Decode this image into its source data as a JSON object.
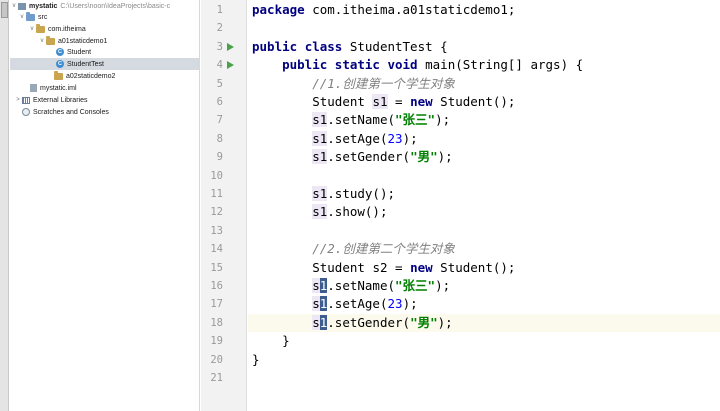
{
  "project_tree": {
    "root": {
      "name": "mystatic",
      "path": "C:\\Users\\noon\\IdeaProjects\\basic-c"
    },
    "items": [
      {
        "label": "src",
        "indent": 1,
        "icon": "source-folder-icon",
        "arrow": "v"
      },
      {
        "label": "com.itheima",
        "indent": 2,
        "icon": "package-icon",
        "arrow": "v"
      },
      {
        "label": "a01staticdemo1",
        "indent": 3,
        "icon": "package-icon",
        "arrow": "v"
      },
      {
        "label": "Student",
        "indent": 4,
        "icon": "class-icon",
        "arrow": ""
      },
      {
        "label": "StudentTest",
        "indent": 4,
        "icon": "class-icon",
        "arrow": "",
        "selected": true
      },
      {
        "label": "a02staticdemo2",
        "indent": 3,
        "icon": "package-icon",
        "arrow": ">"
      },
      {
        "label": "mystatic.iml",
        "indent": 1,
        "icon": "iml-file-icon",
        "arrow": ""
      },
      {
        "label": "External Libraries",
        "indent": 0,
        "icon": "library-icon",
        "arrow": ">"
      },
      {
        "label": "Scratches and Consoles",
        "indent": 0,
        "icon": "scratches-icon",
        "arrow": ""
      }
    ]
  },
  "editor": {
    "line_numbers": [
      "1",
      "2",
      "3",
      "4",
      "5",
      "6",
      "7",
      "8",
      "9",
      "10",
      "11",
      "12",
      "13",
      "14",
      "15",
      "16",
      "17",
      "18",
      "19",
      "20",
      "21"
    ],
    "run_lines": [
      3,
      4
    ],
    "current_line": 18,
    "code": {
      "l1_kw": "package",
      "l1_rest": " com.itheima.a01staticdemo1;",
      "l3_kw1": "public",
      "l3_kw2": "class",
      "l3_rest": " StudentTest {",
      "l4_kw1": "public",
      "l4_kw2": "static",
      "l4_kw3": "void",
      "l4_rest": " main(String[] args) {",
      "l5_comment": "//1.创建第一个学生对象",
      "l6_type": "Student ",
      "l6_var": "s1",
      "l6_mid": " = ",
      "l6_kw": "new",
      "l6_end": " Student();",
      "l7_var": "s1",
      "l7_call": ".setName(",
      "l7_str": "\"张三\"",
      "l7_end": ");",
      "l8_var": "s1",
      "l8_call": ".setAge(",
      "l8_num": "23",
      "l8_end": ");",
      "l9_var": "s1",
      "l9_call": ".setGender(",
      "l9_str": "\"男\"",
      "l9_end": ");",
      "l11_var": "s1",
      "l11_call": ".study();",
      "l12_var": "s1",
      "l12_call": ".show();",
      "l14_comment": "//2.创建第二个学生对象",
      "l15_type": "Student ",
      "l15_var": "s2",
      "l15_mid": " = ",
      "l15_kw": "new",
      "l15_end": " Student();",
      "l16_s": "s",
      "l16_one": "1",
      "l16_call": ".setName(",
      "l16_str": "\"张三\"",
      "l16_end": ");",
      "l17_s": "s",
      "l17_one": "1",
      "l17_call": ".setAge(",
      "l17_num": "23",
      "l17_end": ");",
      "l18_s": "s",
      "l18_one": "1",
      "l18_call": ".setGender(",
      "l18_str": "\"男\"",
      "l18_end": ");",
      "l19": "}",
      "l20": "}"
    }
  },
  "colors": {
    "keyword": "#000080",
    "string": "#008000",
    "number": "#0000ff",
    "comment": "#808080",
    "run_icon": "#4aa14a",
    "selection": "#d5d9e0"
  }
}
